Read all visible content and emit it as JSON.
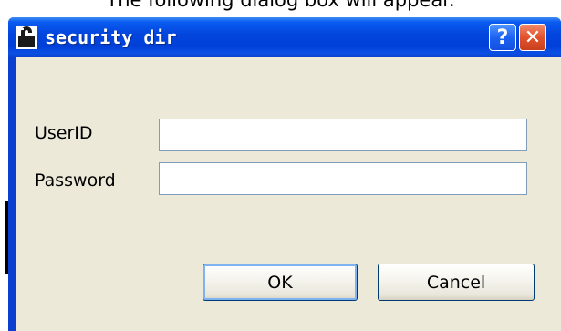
{
  "caption": "The following dialog box will appear.",
  "dialog": {
    "title": "security dir",
    "help_label": "?",
    "close_label": "✕",
    "fields": {
      "userid_label": "UserID",
      "userid_value": "",
      "password_label": "Password",
      "password_value": ""
    },
    "buttons": {
      "ok_label": "OK",
      "cancel_label": "Cancel"
    }
  },
  "icons": {
    "app": "application-lock-icon",
    "help": "help-icon",
    "close": "close-icon"
  },
  "colors": {
    "titlebar": "#0347de",
    "window_border": "#0a3fd0",
    "client_bg": "#ece9d8",
    "close_button": "#e2522c",
    "field_border": "#7f9db9"
  }
}
